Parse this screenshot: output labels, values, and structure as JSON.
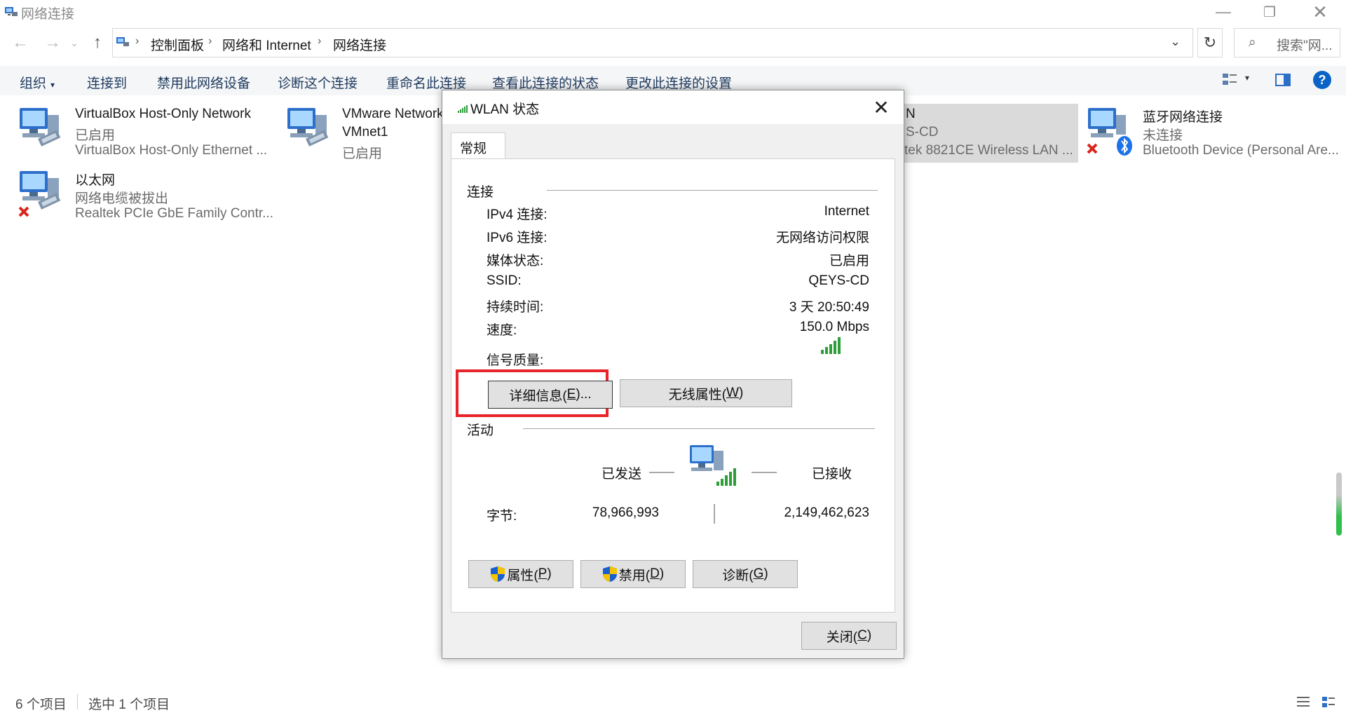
{
  "window": {
    "title": "网络连接"
  },
  "address": {
    "crumbs": [
      "控制面板",
      "网络和 Internet",
      "网络连接"
    ]
  },
  "search": {
    "placeholder": "搜索\"网..."
  },
  "commands": [
    "组织",
    "连接到",
    "禁用此网络设备",
    "诊断这个连接",
    "重命名此连接",
    "查看此连接的状态",
    "更改此连接的设置"
  ],
  "items": [
    {
      "name": "VirtualBox Host-Only Network",
      "status": "已启用",
      "device": "VirtualBox Host-Only Ethernet ..."
    },
    {
      "name": "VMware Network",
      "status": "VMnet1",
      "device": "已启用"
    },
    {
      "name": "N",
      "status": "S-CD",
      "device": "tek 8821CE Wireless LAN ..."
    },
    {
      "name": "蓝牙网络连接",
      "status": "未连接",
      "device": "Bluetooth Device (Personal Are..."
    },
    {
      "name": "以太网",
      "status": "网络电缆被拔出",
      "device": "Realtek PCIe GbE Family Contr..."
    }
  ],
  "statusbar": {
    "count": "6 个项目",
    "selected": "选中 1 个项目"
  },
  "dialog": {
    "title": "WLAN 状态",
    "tab": "常规",
    "connection_label": "连接",
    "rows": [
      {
        "label": "IPv4 连接:",
        "value": "Internet"
      },
      {
        "label": "IPv6 连接:",
        "value": "无网络访问权限"
      },
      {
        "label": "媒体状态:",
        "value": "已启用"
      },
      {
        "label": "SSID:",
        "value": "QEYS-CD"
      },
      {
        "label": "持续时间:",
        "value": "3 天 20:50:49"
      },
      {
        "label": "速度:",
        "value": "150.0 Mbps"
      }
    ],
    "signal_label": "信号质量:",
    "details_button": {
      "text": "详细信息(",
      "key": "E",
      "tail": ")..."
    },
    "wireless_button": {
      "text": "无线属性(",
      "key": "W",
      "tail": ")"
    },
    "activity_label": "活动",
    "sent_label": "已发送",
    "received_label": "已接收",
    "bytes_label": "字节:",
    "bytes_sent": "78,966,993",
    "bytes_received": "2,149,462,623",
    "properties_button": {
      "text": "属性(",
      "key": "P",
      "tail": ")"
    },
    "disable_button": {
      "text": "禁用(",
      "key": "D",
      "tail": ")"
    },
    "diagnose_button": {
      "text": "诊断(",
      "key": "G",
      "tail": ")"
    },
    "close_button": {
      "text": "关闭(",
      "key": "C",
      "tail": ")"
    }
  },
  "colors": {
    "highlight": "#e8232a",
    "signal": "#2e9e3a",
    "accent": "#0a64c8",
    "error": "#d9261c"
  }
}
